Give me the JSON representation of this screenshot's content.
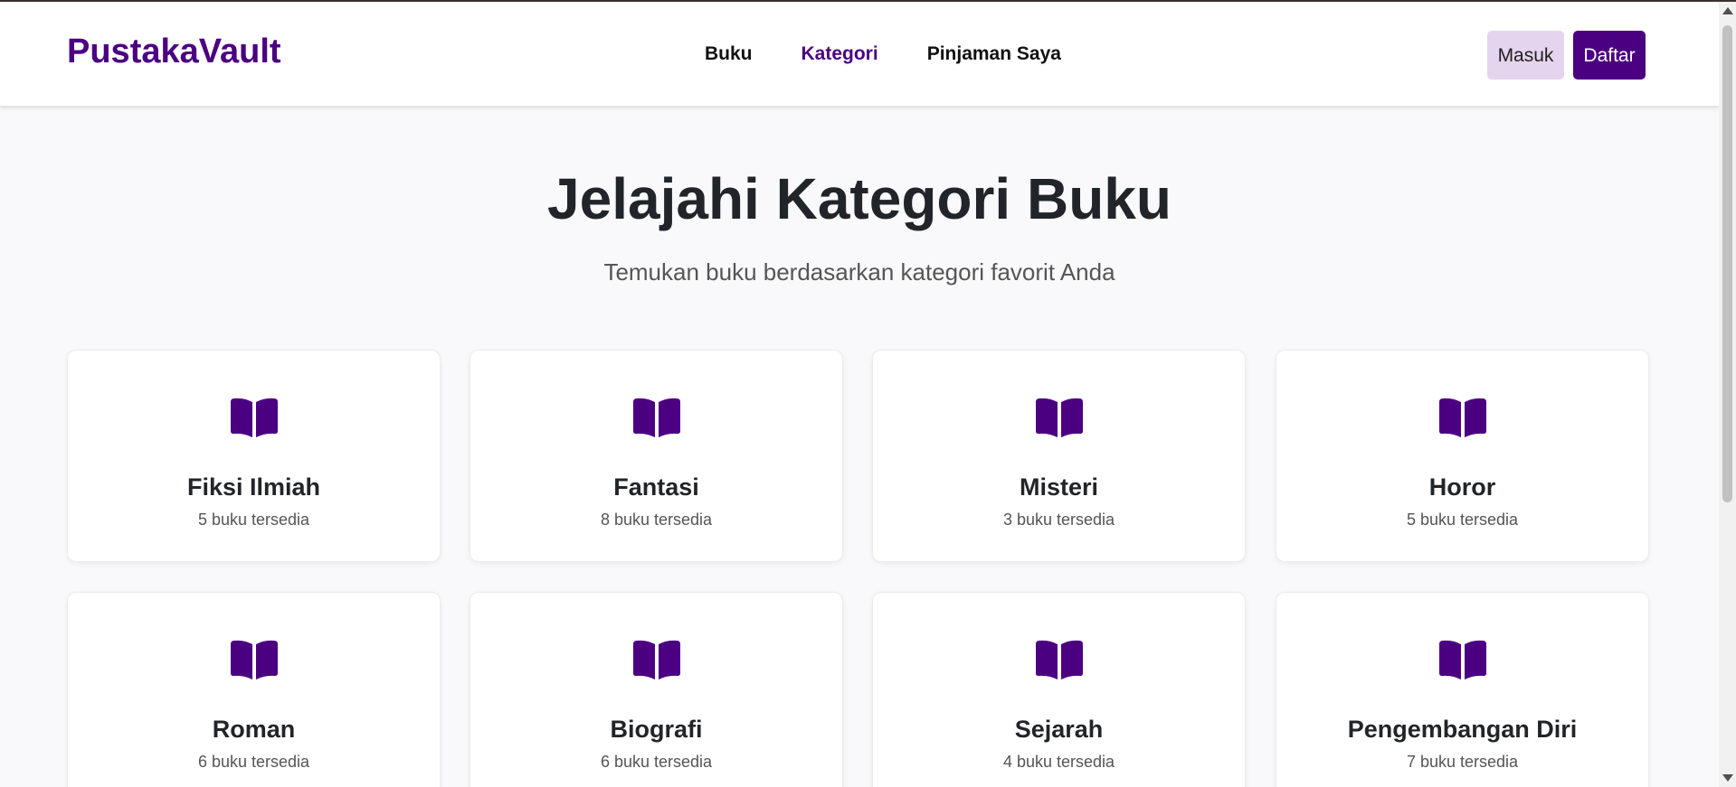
{
  "brand": "PustakaVault",
  "nav": {
    "items": [
      {
        "label": "Buku",
        "active": false
      },
      {
        "label": "Kategori",
        "active": true
      },
      {
        "label": "Pinjaman Saya",
        "active": false
      }
    ]
  },
  "auth": {
    "login_label": "Masuk",
    "register_label": "Daftar"
  },
  "hero": {
    "title": "Jelajahi Kategori Buku",
    "subtitle": "Temukan buku berdasarkan kategori favorit Anda"
  },
  "categories": [
    {
      "name": "Fiksi Ilmiah",
      "count": "5 buku tersedia"
    },
    {
      "name": "Fantasi",
      "count": "8 buku tersedia"
    },
    {
      "name": "Misteri",
      "count": "3 buku tersedia"
    },
    {
      "name": "Horor",
      "count": "5 buku tersedia"
    },
    {
      "name": "Roman",
      "count": "6 buku tersedia"
    },
    {
      "name": "Biografi",
      "count": "6 buku tersedia"
    },
    {
      "name": "Sejarah",
      "count": "4 buku tersedia"
    },
    {
      "name": "Pengembangan Diri",
      "count": "7 buku tersedia"
    }
  ],
  "icons": {
    "category_icon": "open-book-icon"
  },
  "colors": {
    "accent": "#4b0082",
    "login_bg": "#e5d4ee"
  }
}
